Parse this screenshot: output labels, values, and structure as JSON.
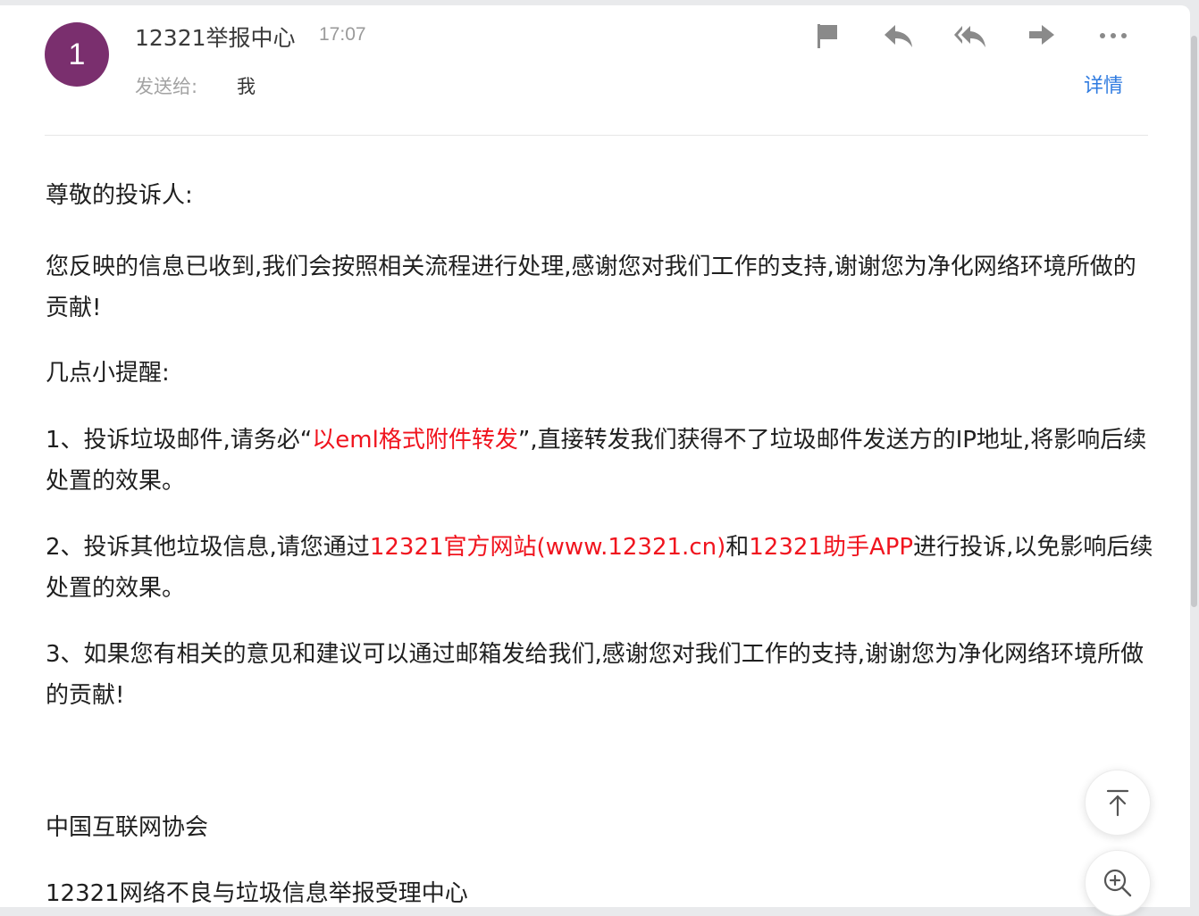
{
  "sender": {
    "avatar_letter": "1",
    "avatar_color": "#7a2f6e",
    "name": "12321举报中心",
    "time": "17:07",
    "to_label": "发送给:",
    "to_value": "我",
    "details_label": "详情"
  },
  "toolbar": {
    "icons": [
      "flag-icon",
      "reply-icon",
      "reply-all-icon",
      "forward-icon",
      "more-icon"
    ]
  },
  "email": {
    "greeting": "尊敬的投诉人:",
    "paragraph1": "您反映的信息已收到,我们会按照相关流程进行处理,感谢您对我们工作的支持,谢谢您为净化网络环境所做的贡献!",
    "reminder_heading": "几点小提醒:",
    "item1": {
      "prefix": "1、投诉垃圾邮件,请务必“",
      "highlight": "以eml格式附件转发",
      "suffix": "”,直接转发我们获得不了垃圾邮件发送方的IP地址,将影响后续处置的效果。"
    },
    "item2": {
      "prefix": "2、投诉其他垃圾信息,请您通过",
      "highlight1": "12321官方网站(www.12321.cn)",
      "middle": "和",
      "highlight2": "12321助手APP",
      "suffix": "进行投诉,以免影响后续处置的效果。"
    },
    "item3": "3、如果您有相关的意见和建议可以通过邮箱发给我们,感谢您对我们工作的支持,谢谢您为净化网络环境所做的贡献!",
    "signature1": "中国互联网协会",
    "signature2": "12321网络不良与垃圾信息举报受理中心"
  },
  "colors": {
    "highlight": "#f0141e",
    "link": "#2f7be0"
  }
}
